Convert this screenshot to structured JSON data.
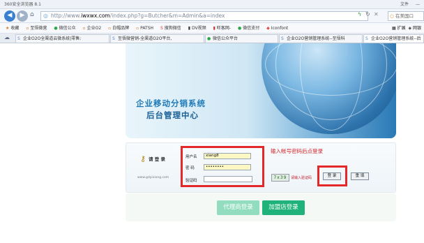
{
  "browser": {
    "title": "360安全浏览器 8.1",
    "menu": "文件",
    "url_prefix": "http://www.",
    "url_host": "iwxwx.com",
    "url_path": "/index.php?g=Butcher&m=Admin&a=index",
    "search_placeholder": "在美国口",
    "bookmarks": [
      "收藏",
      "至悟微营",
      "微信公众",
      "企业O2",
      "白帽品牌",
      "PATSH",
      "搜狗微信",
      "DV视频",
      "旺客网-",
      "微信支付",
      "Iconfont"
    ],
    "bookmarks_right": [
      "扩展",
      "网银"
    ],
    "tabs": [
      "企业O2O全渠道云微系统|零售:",
      "至悟微营销-全渠道O2O平台,",
      "微信公众平台",
      "企业O2O营销管理系统--至悟科",
      "企业O2O营销管理系统--后"
    ]
  },
  "banner": {
    "title": "企业移动分销系统",
    "subtitle": "后台管理中心"
  },
  "login": {
    "label": "请 登 录",
    "site_url": "www.gdyixiong.com",
    "username_label": "用户名",
    "username_value": "xiang8",
    "password_label": "密 码",
    "password_value": "••••••••",
    "captcha_label": "验证码",
    "captcha_value": "",
    "captcha_image_text": "7x39",
    "captcha_hint": "请输入验证码",
    "hint": "输入帐号密码后点登录",
    "login_button": "登 录",
    "reset_button": "重 填"
  },
  "bottom": {
    "agent_login": "代理商登录",
    "store_login": "加盟店登录"
  },
  "colors": {
    "accent_red": "#e4282a",
    "agent_btn": "#92dcc0",
    "store_btn": "#1fb27a",
    "title_blue": "#1e7ab8"
  }
}
